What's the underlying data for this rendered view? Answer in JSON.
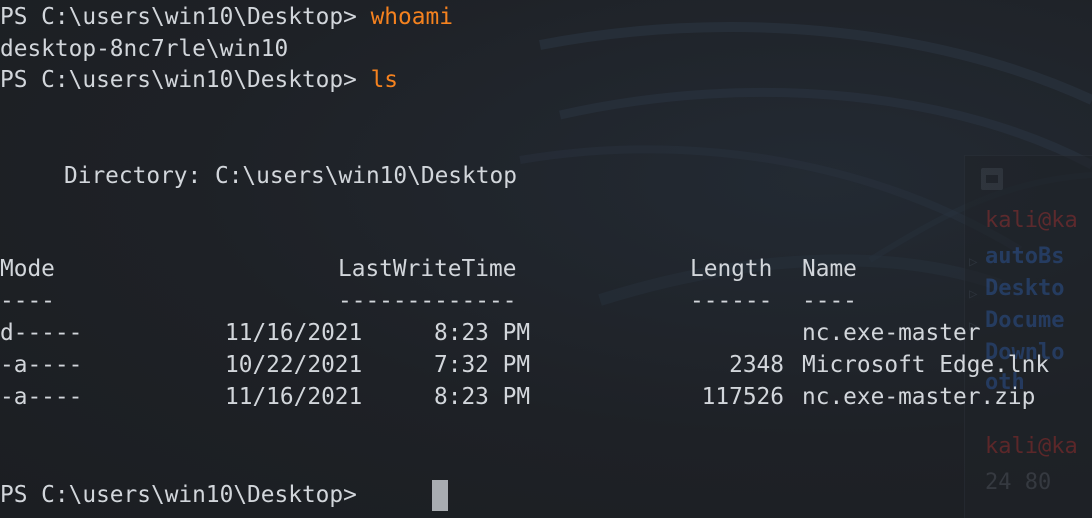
{
  "session": {
    "prompt": "PS C:\\users\\win10\\Desktop> ",
    "whoami_cmd": "whoami",
    "whoami_output": "desktop-8nc7rle\\win10",
    "ls_cmd": "ls",
    "directory_line": "Directory: C:\\users\\win10\\Desktop"
  },
  "listing": {
    "headers": {
      "mode": "Mode",
      "lastwrite": "LastWriteTime",
      "length": "Length",
      "name": "Name"
    },
    "underlines": {
      "mode": "----",
      "lastwrite": "-------------",
      "length": "------",
      "name": "----"
    },
    "rows": [
      {
        "mode": "d-----",
        "date": "11/16/2021",
        "time": "8:23 PM",
        "length": "",
        "name": "nc.exe-master"
      },
      {
        "mode": "-a----",
        "date": "10/22/2021",
        "time": "7:32 PM",
        "length": "2348",
        "name": "Microsoft Edge.lnk"
      },
      {
        "mode": "-a----",
        "date": "11/16/2021",
        "time": "8:23 PM",
        "length": "117526",
        "name": "nc.exe-master.zip"
      }
    ]
  },
  "background_window": {
    "prompt1": "kali@ka",
    "dirs": [
      "autoBs",
      "Deskto",
      "Docume",
      "Downlo",
      "oth"
    ],
    "prompt2": "kali@ka",
    "size_text": "24 80"
  },
  "colors": {
    "background": "#1e2126",
    "text": "#d2d6db",
    "command": "#f5821f",
    "cursor": "#a8acb1",
    "bg_prompt": "#8f2d2d",
    "bg_dir": "#2a4f8c"
  }
}
